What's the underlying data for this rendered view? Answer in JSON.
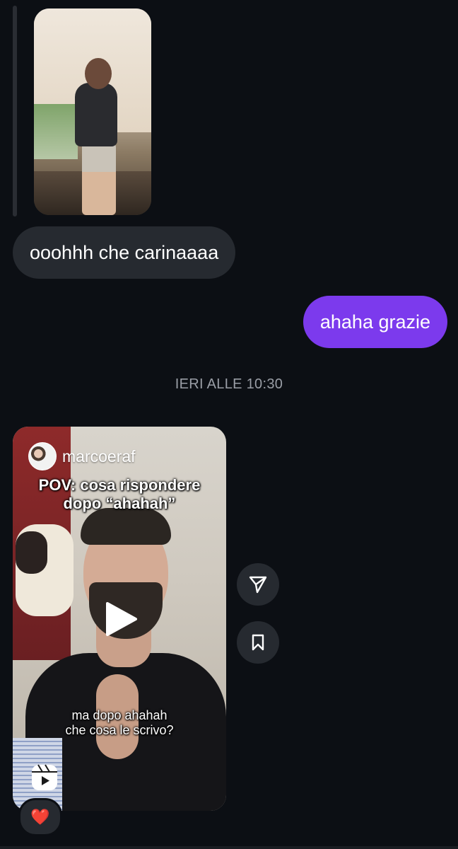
{
  "messages": {
    "incoming_text": "ooohhh che carinaaaa",
    "outgoing_text": "ahaha grazie",
    "timestamp": "IERI ALLE 10:30"
  },
  "reel": {
    "username": "marcoeraf",
    "caption_line1": "POV: cosa rispondere",
    "caption_line2": "dopo “ahahah”",
    "subtitle_line1": "ma dopo ahahah",
    "subtitle_line2": "che cosa le scrivo?"
  },
  "reaction": {
    "emoji": "❤️"
  },
  "colors": {
    "background": "#0c0f14",
    "incoming_bubble": "#262a30",
    "outgoing_bubble": "#7c3aed",
    "timestamp_text": "#9a9ea6"
  },
  "icons": [
    "send-icon",
    "bookmark-icon",
    "play-icon",
    "reels-icon"
  ]
}
